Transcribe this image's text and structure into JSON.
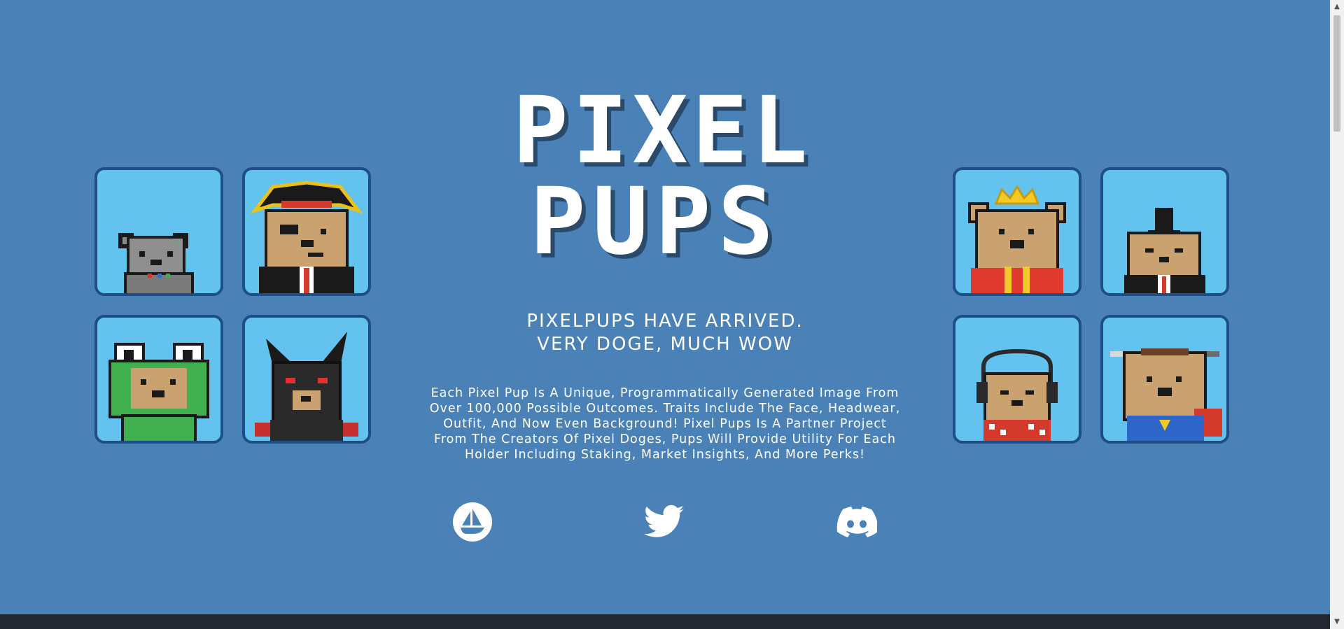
{
  "brand": {
    "logo_line1": "PIXEL",
    "logo_line2": "PUPS"
  },
  "hero": {
    "tagline_line1": "PIXELPUPS HAVE ARRIVED.",
    "tagline_line2": "VERY DOGE, MUCH WOW",
    "description": "Each Pixel Pup Is A Unique, Programmatically Generated Image From Over 100,000 Possible Outcomes. Traits Include The Face, Headwear, Outfit, And Now Even Background! Pixel Pups Is A Partner Project From The Creators Of Pixel Doges, Pups Will Provide Utility For Each Holder Including Staking, Market Insights, And More Perks!"
  },
  "social": [
    {
      "name": "opensea-icon"
    },
    {
      "name": "twitter-icon"
    },
    {
      "name": "discord-icon"
    }
  ],
  "colors": {
    "background": "#4a82b7",
    "card_fill": "#64c2ef",
    "card_border": "#1d4f86",
    "text": "#ffffff",
    "footer": "#23272f"
  }
}
